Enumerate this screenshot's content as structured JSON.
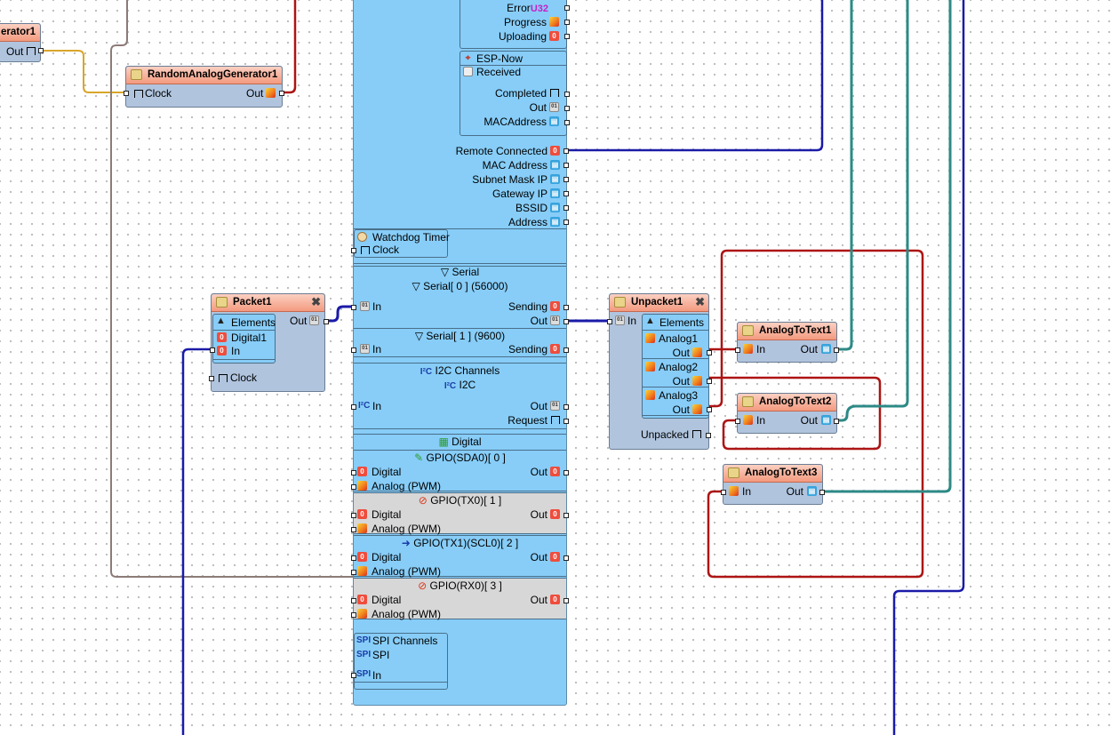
{
  "colors": {
    "wire_orange": "#d9a52a",
    "wire_brown": "#8c7b78",
    "wire_red": "#ad1414",
    "wire_blue": "#1a1aa8",
    "wire_teal": "#2d8a86",
    "component_body": "#b0c4de",
    "component_header": "#f39a7f",
    "board_body": "#87cdf8",
    "disabled_pin": "#d7d7d7"
  },
  "generator1": {
    "title": "erator1",
    "out": "Out"
  },
  "random_gen": {
    "title": "RandomAnalogGenerator1",
    "clock": "Clock",
    "out": "Out"
  },
  "packet": {
    "title": "Packet1",
    "elements": "Elements",
    "digital1": "Digital1",
    "in": "In",
    "out": "Out",
    "clock": "Clock"
  },
  "unpacket": {
    "title": "Unpacket1",
    "in": "In",
    "elements": "Elements",
    "items": [
      {
        "name": "Analog1",
        "out": "Out"
      },
      {
        "name": "Analog2",
        "out": "Out"
      },
      {
        "name": "Analog3",
        "out": "Out"
      }
    ],
    "unpacked": "Unpacked"
  },
  "analog_to_text": [
    {
      "title": "AnalogToText1",
      "in": "In",
      "out": "Out"
    },
    {
      "title": "AnalogToText2",
      "in": "In",
      "out": "Out"
    },
    {
      "title": "AnalogToText3",
      "in": "In",
      "out": "Out"
    }
  ],
  "board": {
    "ota": {
      "error": "Error",
      "error_badge": "U32",
      "progress": "Progress",
      "uploading": "Uploading"
    },
    "espnow": {
      "title": "ESP-Now",
      "received": "Received",
      "completed": "Completed",
      "out": "Out",
      "mac": "MACAddress"
    },
    "wifi": {
      "remote_connected": "Remote Connected",
      "mac_address": "MAC Address",
      "subnet_mask": "Subnet Mask IP",
      "gateway": "Gateway IP",
      "bssid": "BSSID",
      "address": "Address"
    },
    "watchdog": {
      "title": "Watchdog Timer",
      "clock": "Clock"
    },
    "serial": {
      "title": "Serial",
      "s0": "Serial[ 0 ] (56000)",
      "s0_in": "In",
      "s0_sending": "Sending",
      "s0_out": "Out",
      "s1": "Serial[ 1 ] (9600)",
      "s1_in": "In",
      "s1_sending": "Sending"
    },
    "i2c": {
      "channels": "I2C Channels",
      "i2c": "I2C",
      "in": "In",
      "out": "Out",
      "request": "Request"
    },
    "digital": {
      "title": "Digital",
      "gpios": [
        {
          "name": "GPIO(SDA0)[ 0 ]",
          "digital": "Digital",
          "analog": "Analog (PWM)",
          "out": "Out"
        },
        {
          "name": "GPIO(TX0)[ 1 ]",
          "digital": "Digital",
          "analog": "Analog (PWM)",
          "out": "Out"
        },
        {
          "name": "GPIO(TX1)(SCL0)[ 2 ]",
          "digital": "Digital",
          "analog": "Analog (PWM)",
          "out": "Out"
        },
        {
          "name": "GPIO(RX0)[ 3 ]",
          "digital": "Digital",
          "analog": "Analog (PWM)",
          "out": "Out"
        }
      ]
    },
    "spi": {
      "channels": "SPI Channels",
      "spi": "SPI",
      "in": "In"
    }
  }
}
